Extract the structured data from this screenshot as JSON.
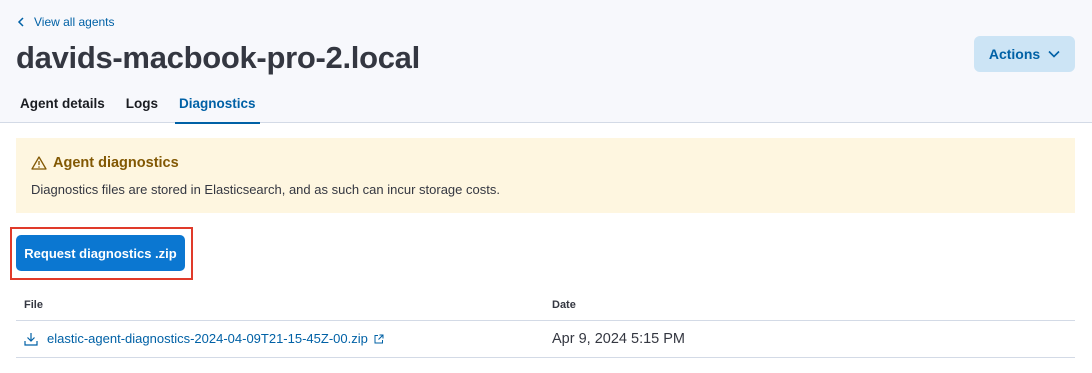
{
  "header": {
    "back_link": "View all agents",
    "title": "davids-macbook-pro-2.local",
    "actions_label": "Actions"
  },
  "tabs": [
    {
      "label": "Agent details",
      "active": false
    },
    {
      "label": "Logs",
      "active": false
    },
    {
      "label": "Diagnostics",
      "active": true
    }
  ],
  "callout": {
    "title": "Agent diagnostics",
    "body": "Diagnostics files are stored in Elasticsearch, and as such can incur storage costs."
  },
  "request_button": "Request diagnostics .zip",
  "table": {
    "columns": [
      "File",
      "Date"
    ],
    "rows": [
      {
        "file": "elastic-agent-diagnostics-2024-04-09T21-15-45Z-00.zip",
        "date": "Apr 9, 2024 5:15 PM"
      }
    ]
  },
  "colors": {
    "link": "#0061a6",
    "primary_button": "#0b77d1",
    "warning_bg": "#fef6e0",
    "warning_text": "#825803",
    "highlight": "#e03a2a"
  }
}
